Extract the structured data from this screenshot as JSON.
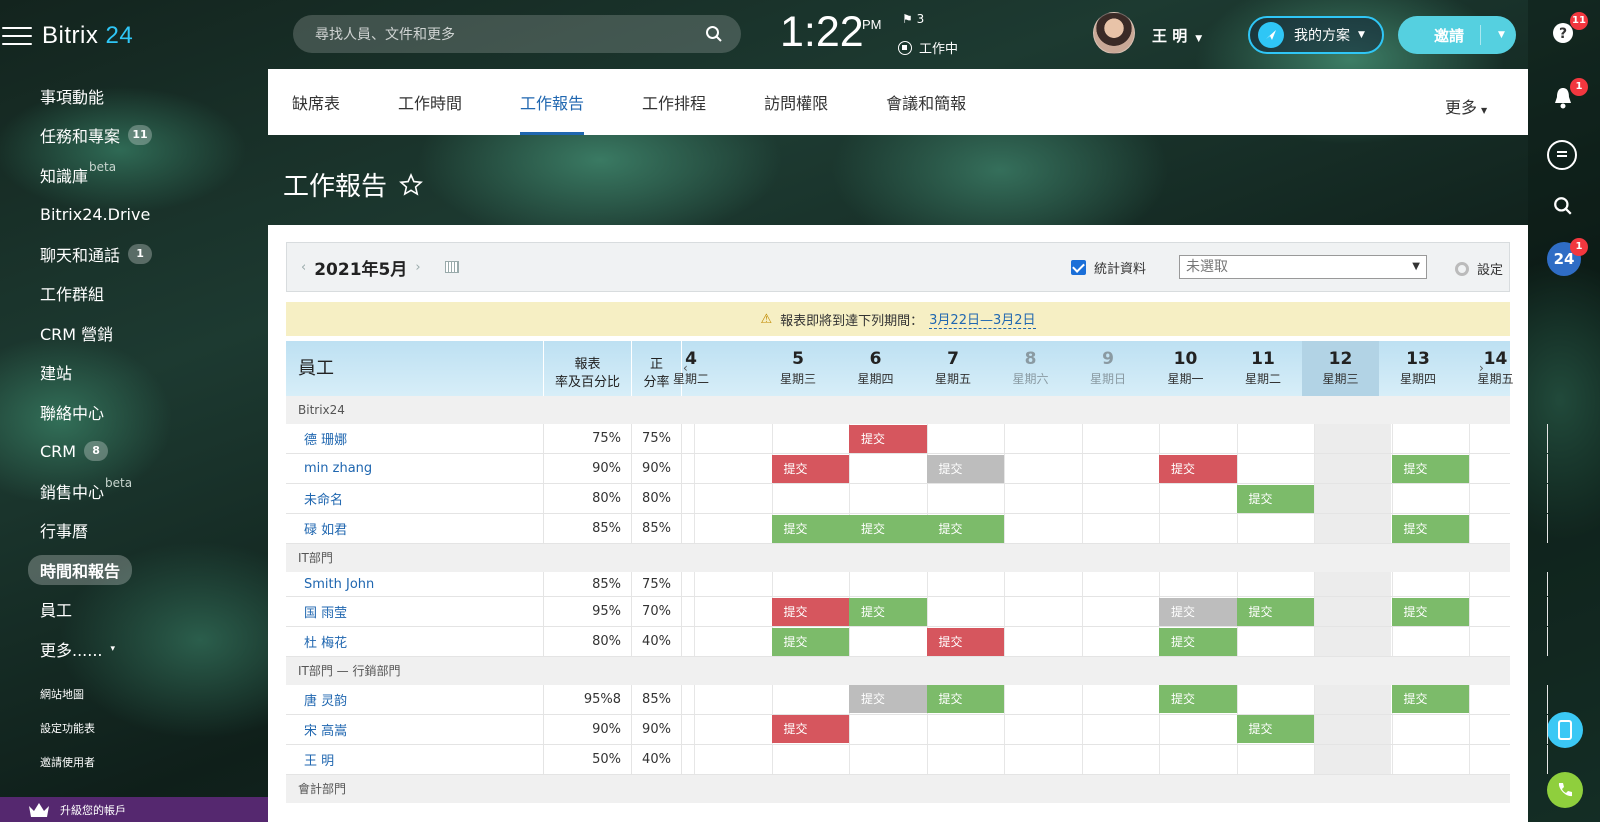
{
  "app": {
    "logo_text": "Bitrix",
    "logo_num": "24"
  },
  "search": {
    "placeholder": "尋找人員、文件和更多"
  },
  "clock": {
    "time": "1:22",
    "ampm": "PM",
    "flags": "3",
    "status": "工作中"
  },
  "user": {
    "name": "王 明"
  },
  "header_buttons": {
    "plan": "我的方案",
    "invite": "邀請"
  },
  "sidebar": {
    "items": [
      {
        "label": "事項動能"
      },
      {
        "label": "任務和專案",
        "badge": "11"
      },
      {
        "label": "知識庫",
        "sup": "beta"
      },
      {
        "label": "Bitrix24.Drive"
      },
      {
        "label": "聊天和通話",
        "badge": "1"
      },
      {
        "label": "工作群組"
      },
      {
        "label": "CRM 營銷"
      },
      {
        "label": "建站"
      },
      {
        "label": "聯絡中心"
      },
      {
        "label": "CRM",
        "badge": "8"
      },
      {
        "label": "銷售中心",
        "sup": "beta"
      },
      {
        "label": "行事曆"
      },
      {
        "label": "時間和報告",
        "active": true
      },
      {
        "label": "員工"
      },
      {
        "label": "更多......"
      }
    ],
    "footer": [
      "網站地圖",
      "設定功能表",
      "邀請使用者"
    ],
    "upgrade": "升級您的帳戶"
  },
  "right_rail": {
    "help_badge": "11",
    "bell_badge": "1",
    "b24_badge": "1",
    "b24_label": "24"
  },
  "tabs": [
    "缺席表",
    "工作時間",
    "工作報告",
    "工作排程",
    "訪問權限",
    "會議和簡報"
  ],
  "active_tab": "工作報告",
  "tabs_more": "更多",
  "page": {
    "title": "工作報告"
  },
  "toolbar": {
    "month": "2021年5月",
    "stats_label": "統計資料",
    "select_value": "未選取",
    "settings": "設定"
  },
  "notice": {
    "text": "報表即將到達下列期間：",
    "link": "3月22日—3月2日"
  },
  "table": {
    "headers": {
      "employee": "員工",
      "rate_line1": "報表",
      "rate_line2": "率及百分比",
      "pos_line1": "正",
      "pos_line2": "分率"
    },
    "days": [
      {
        "num": "4",
        "wd": "星期二"
      },
      {
        "num": "5",
        "wd": "星期三"
      },
      {
        "num": "6",
        "wd": "星期四"
      },
      {
        "num": "7",
        "wd": "星期五"
      },
      {
        "num": "8",
        "wd": "星期六",
        "weekend": true
      },
      {
        "num": "9",
        "wd": "星期日",
        "weekend": true
      },
      {
        "num": "10",
        "wd": "星期一"
      },
      {
        "num": "11",
        "wd": "星期二"
      },
      {
        "num": "12",
        "wd": "星期三",
        "today": true
      },
      {
        "num": "13",
        "wd": "星期四"
      },
      {
        "num": "14",
        "wd": "星期五"
      }
    ],
    "submit_label": "提交",
    "groups": [
      {
        "name": "Bitrix24",
        "rows": [
          {
            "name": "德 珊娜",
            "rate": "75%",
            "pos": "75%",
            "marks": [
              [
                2,
                0,
                "red"
              ]
            ]
          },
          {
            "name": "min zhang",
            "rate": "90%",
            "pos": "90%",
            "marks": [
              [
                1,
                0,
                "red"
              ],
              [
                3,
                0,
                "grey"
              ],
              [
                6,
                0,
                "red"
              ],
              [
                9,
                0,
                "green"
              ]
            ]
          },
          {
            "name": "未命名",
            "rate": "80%",
            "pos": "80%",
            "marks": [
              [
                7,
                0,
                "green"
              ]
            ]
          },
          {
            "name": "碌 如君",
            "rate": "85%",
            "pos": "85%",
            "marks": [
              [
                1,
                0,
                "green"
              ],
              [
                2,
                0,
                "green"
              ],
              [
                3,
                0,
                "green"
              ],
              [
                9,
                0,
                "green"
              ]
            ]
          }
        ]
      },
      {
        "name": "IT部門",
        "rows": [
          {
            "name": "Smith John",
            "rate": "85%",
            "pos": "75%",
            "marks": []
          },
          {
            "name": "国 雨莹",
            "rate": "95%",
            "pos": "70%",
            "marks": [
              [
                1,
                0,
                "red"
              ],
              [
                2,
                0,
                "green"
              ],
              [
                6,
                0,
                "grey"
              ],
              [
                7,
                0,
                "green"
              ],
              [
                9,
                0,
                "green"
              ]
            ]
          },
          {
            "name": "杜 梅花",
            "rate": "80%",
            "pos": "40%",
            "marks": [
              [
                1,
                0,
                "green"
              ],
              [
                3,
                0,
                "red"
              ],
              [
                6,
                0,
                "green"
              ]
            ]
          }
        ]
      },
      {
        "name": "IT部門 — 行銷部門",
        "rows": [
          {
            "name": "唐 灵韵",
            "rate": "95%8",
            "pos": "85%",
            "marks": [
              [
                2,
                1,
                "grey"
              ],
              [
                3,
                1,
                "green"
              ],
              [
                6,
                1,
                "green"
              ],
              [
                9,
                1,
                "green"
              ]
            ]
          },
          {
            "name": "宋 高嵩",
            "rate": "90%",
            "pos": "90%",
            "marks": [
              [
                1,
                1,
                "red"
              ],
              [
                7,
                1,
                "green"
              ]
            ]
          },
          {
            "name": "王 明",
            "rate": "50%",
            "pos": "40%",
            "marks": []
          }
        ]
      },
      {
        "name": "會計部門",
        "rows": []
      }
    ]
  }
}
